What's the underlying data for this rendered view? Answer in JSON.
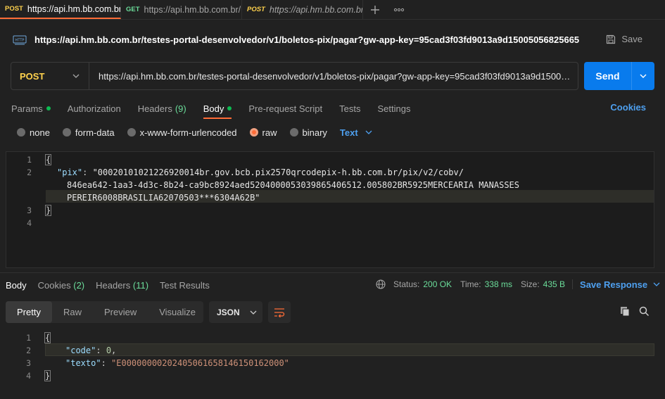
{
  "tabs": [
    {
      "method": "POST",
      "url": "https://api.hm.bb.com.br",
      "active": true
    },
    {
      "method": "GET",
      "url": "https://api.hm.bb.com.br/",
      "active": false
    },
    {
      "method": "POST",
      "url": "https://api.hm.bb.com.br",
      "active": false
    }
  ],
  "header": {
    "url_title": "https://api.hm.bb.com.br/testes-portal-desenvolvedor/v1/boletos-pix/pagar?gw-app-key=95cad3f03fd9013a9d15005056825665",
    "save_label": "Save"
  },
  "request": {
    "method": "POST",
    "url": "https://api.hm.bb.com.br/testes-portal-desenvolvedor/v1/boletos-pix/pagar?gw-app-key=95cad3f03fd9013a9d15005056825665",
    "send_label": "Send"
  },
  "request_tabs": {
    "params": "Params",
    "authorization": "Authorization",
    "headers": "Headers",
    "headers_count": "(9)",
    "body": "Body",
    "pre_request": "Pre-request Script",
    "tests": "Tests",
    "settings": "Settings",
    "cookies": "Cookies"
  },
  "body_types": {
    "none": "none",
    "form_data": "form-data",
    "urlencoded": "x-www-form-urlencoded",
    "raw": "raw",
    "binary": "binary",
    "format": "Text"
  },
  "request_body": {
    "line_numbers": [
      "1",
      "2",
      "3",
      "4"
    ],
    "open": "{",
    "key": "\"pix\"",
    "colon": ": ",
    "value_1": "\"00020101021226920014br.gov.bcb.pix2570qrcodepix-h.bb.com.br/pix/v2/cobv/",
    "value_2": "846ea642-1aa3-4d3c-8b24-ca9bc8924aed5204000053039865406512.005802BR5925MERCEARIA MANASSES",
    "value_3": "PEREIR6008BRASILIA62070503***6304A62B\"",
    "close": "}"
  },
  "response": {
    "tabs": {
      "body": "Body",
      "cookies": "Cookies",
      "cookies_count": "(2)",
      "headers": "Headers",
      "headers_count": "(11)",
      "test_results": "Test Results"
    },
    "status_label": "Status:",
    "status_value": "200 OK",
    "time_label": "Time:",
    "time_value": "338 ms",
    "size_label": "Size:",
    "size_value": "435 B",
    "save_response": "Save Response",
    "views": {
      "pretty": "Pretty",
      "raw": "Raw",
      "preview": "Preview",
      "visualize": "Visualize"
    },
    "format": "JSON",
    "body": {
      "line_numbers": [
        "1",
        "2",
        "3",
        "4"
      ],
      "open": "{",
      "code_key": "\"code\"",
      "code_value": "0",
      "texto_key": "\"texto\"",
      "texto_value": "\"E00000000202405061658146150162000\"",
      "close": "}"
    }
  },
  "colors": {
    "accent_orange": "#ff6c37",
    "send_blue": "#097bed",
    "post_yellow": "#ffd24d",
    "get_green": "#6bdd9a",
    "link_blue": "#4ea0f0"
  }
}
